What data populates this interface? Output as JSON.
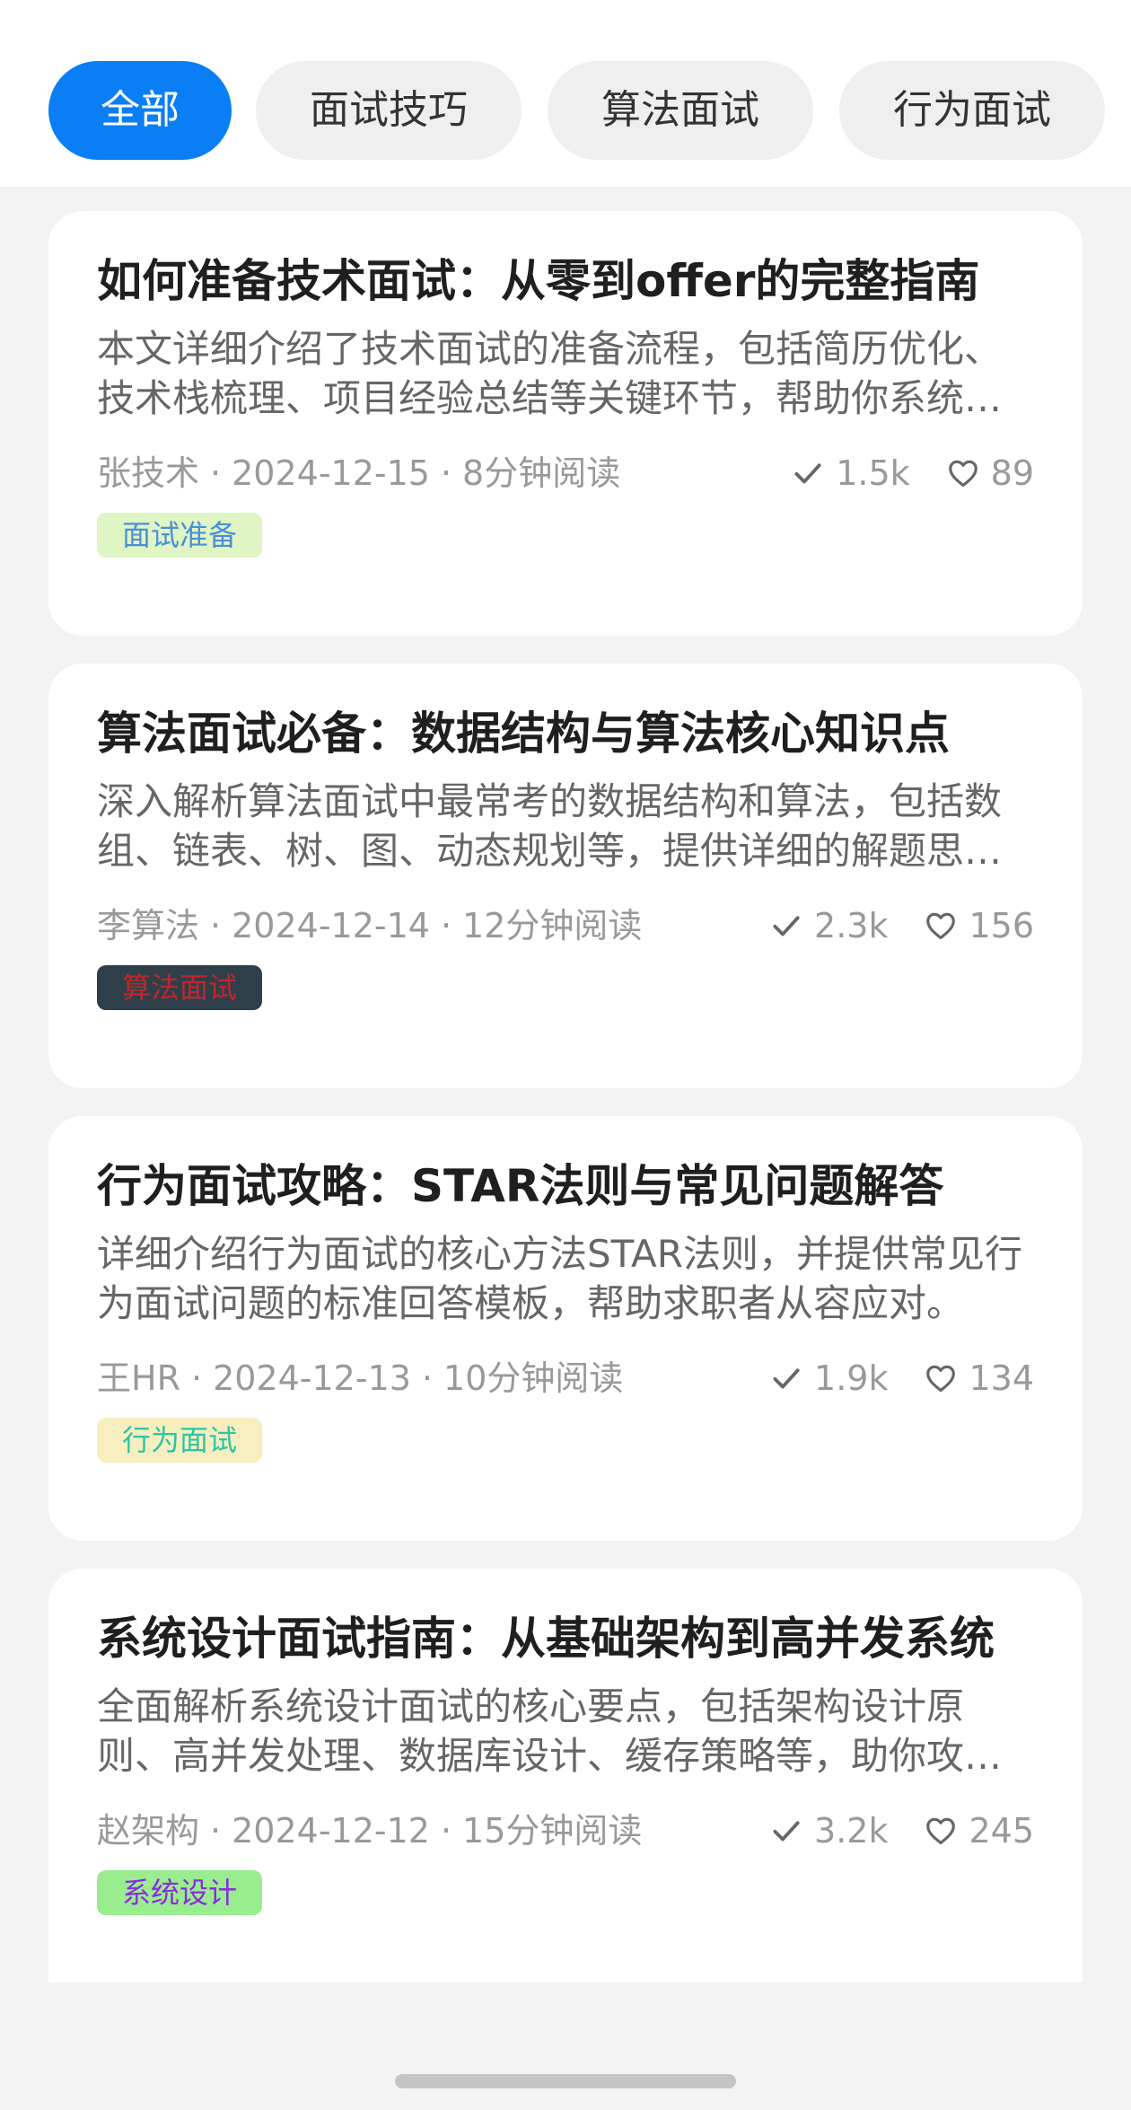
{
  "tabs": [
    {
      "label": "全部",
      "active": true
    },
    {
      "label": "面试技巧",
      "active": false
    },
    {
      "label": "算法面试",
      "active": false
    },
    {
      "label": "行为面试",
      "active": false
    }
  ],
  "articles": [
    {
      "title": "如何准备技术面试：从零到offer的完整指南",
      "summary": "本文详细介绍了技术面试的准备流程，包括简历优化、技术栈梳理、项目经验总结等关键环节，帮助你系统地准备每一场技术面试。",
      "author": "张技术",
      "date": "2024-12-15",
      "read_time": "8分钟阅读",
      "views": "1.5k",
      "likes": "89",
      "tag": "面试准备",
      "tag_bg": "#dff5c4",
      "tag_color": "#4a90d9"
    },
    {
      "title": "算法面试必备：数据结构与算法核心知识点",
      "summary": "深入解析算法面试中最常考的数据结构和算法，包括数组、链表、树、图、动态规划等，提供详细的解题思路。",
      "author": "李算法",
      "date": "2024-12-14",
      "read_time": "12分钟阅读",
      "views": "2.3k",
      "likes": "156",
      "tag": "算法面试",
      "tag_bg": "#2e3f4a",
      "tag_color": "#c0262d"
    },
    {
      "title": "行为面试攻略：STAR法则与常见问题解答",
      "summary": "详细介绍行为面试的核心方法STAR法则，并提供常见行为面试问题的标准回答模板，帮助求职者从容应对。",
      "author": "王HR",
      "date": "2024-12-13",
      "read_time": "10分钟阅读",
      "views": "1.9k",
      "likes": "134",
      "tag": "行为面试",
      "tag_bg": "#f7efc0",
      "tag_color": "#2ec4a6"
    },
    {
      "title": "系统设计面试指南：从基础架构到高并发系统",
      "summary": "全面解析系统设计面试的核心要点，包括架构设计原则、高并发处理、数据库设计、缓存策略等，助你攻克系统设计难题。",
      "author": "赵架构",
      "date": "2024-12-12",
      "read_time": "15分钟阅读",
      "views": "3.2k",
      "likes": "245",
      "tag": "系统设计",
      "tag_bg": "#9aed8f",
      "tag_color": "#8a2be2"
    }
  ],
  "icons": {
    "views": "check-icon",
    "likes": "heart-icon"
  }
}
